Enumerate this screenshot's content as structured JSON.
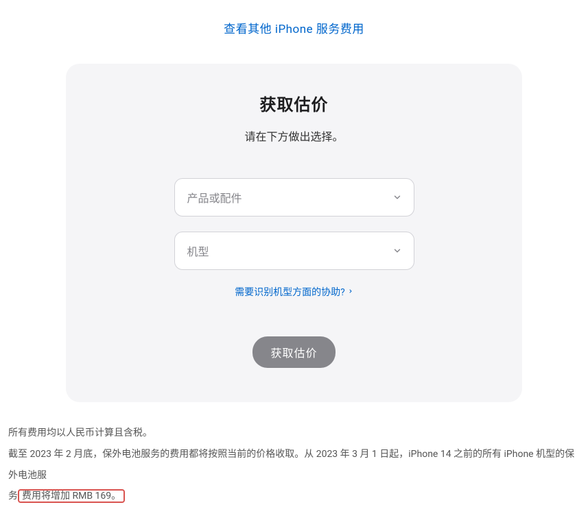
{
  "topLink": "查看其他 iPhone 服务费用",
  "card": {
    "title": "获取估价",
    "subtitle": "请在下方做出选择。",
    "select1Placeholder": "产品或配件",
    "select2Placeholder": "机型",
    "helpLink": "需要识别机型方面的协助?",
    "button": "获取估价"
  },
  "footer": {
    "line1": "所有费用均以人民币计算且含税。",
    "line2_part1": "截至 2023 年 2 月底，保外电池服务的费用都将按照当前的价格收取。从 2023 年 3 月 1 日起，iPhone 14 之前的所有 iPhone 机型的保外电池服",
    "line2_part2": "务",
    "line2_highlight": "费用将增加 RMB 169。"
  }
}
